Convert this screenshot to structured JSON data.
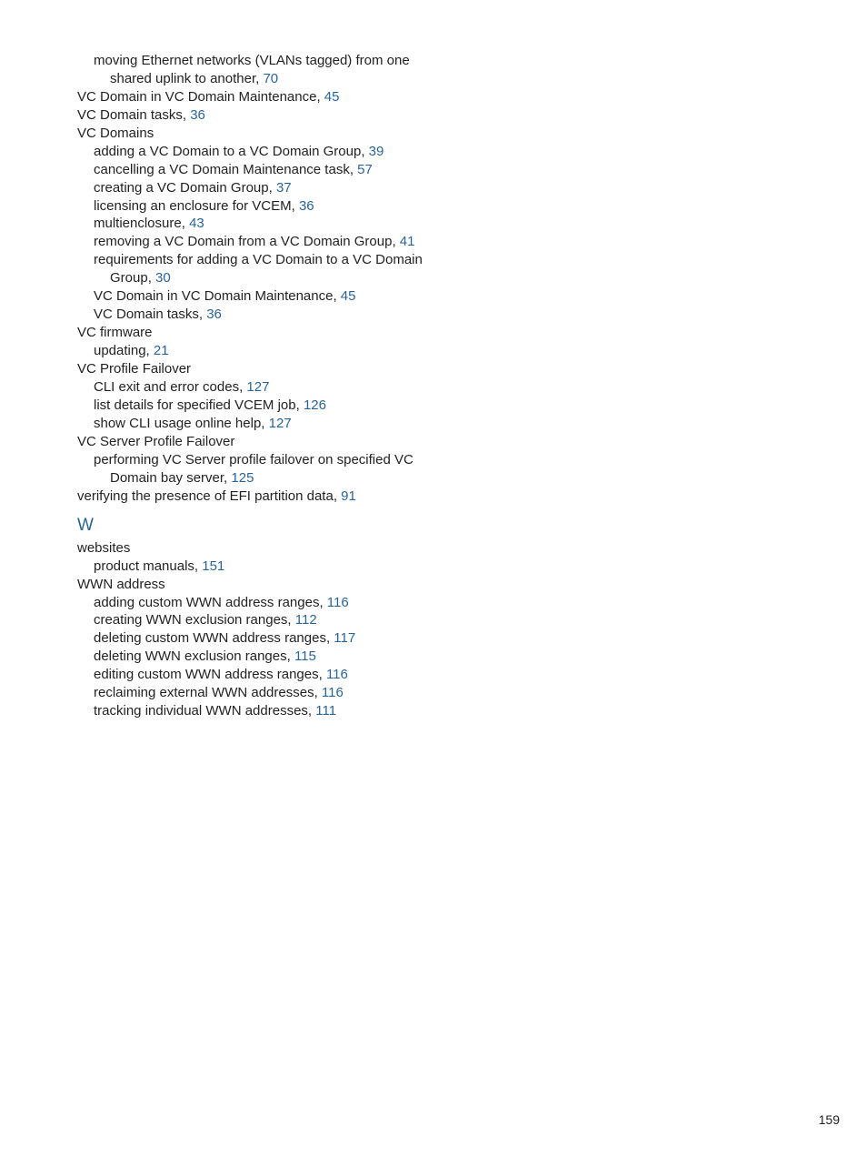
{
  "entries": [
    {
      "indent": 1,
      "text": "moving Ethernet networks (VLANs tagged) from one"
    },
    {
      "indent": 2,
      "text": "shared uplink to another,",
      "page": "70"
    },
    {
      "indent": 0,
      "text": "VC Domain in VC Domain Maintenance,",
      "page": "45"
    },
    {
      "indent": 0,
      "text": "VC Domain tasks,",
      "page": "36"
    },
    {
      "indent": 0,
      "text": "VC Domains"
    },
    {
      "indent": 1,
      "text": "adding a VC Domain to a VC Domain Group,",
      "page": "39"
    },
    {
      "indent": 1,
      "text": "cancelling a VC Domain Maintenance task,",
      "page": "57"
    },
    {
      "indent": 1,
      "text": "creating a VC Domain Group,",
      "page": "37"
    },
    {
      "indent": 1,
      "text": "licensing an enclosure for VCEM,",
      "page": "36"
    },
    {
      "indent": 1,
      "text": "multienclosure,",
      "page": "43"
    },
    {
      "indent": 1,
      "text": "removing a VC Domain from a VC Domain Group,",
      "page": "41"
    },
    {
      "indent": 1,
      "text": "requirements for adding a VC Domain to a VC Domain"
    },
    {
      "indent": 2,
      "text": "Group,",
      "page": "30"
    },
    {
      "indent": 1,
      "text": "VC Domain in VC Domain Maintenance,",
      "page": "45"
    },
    {
      "indent": 1,
      "text": "VC Domain tasks,",
      "page": "36"
    },
    {
      "indent": 0,
      "text": "VC firmware"
    },
    {
      "indent": 1,
      "text": "updating,",
      "page": "21"
    },
    {
      "indent": 0,
      "text": "VC Profile Failover"
    },
    {
      "indent": 1,
      "text": "CLI exit and error codes,",
      "page": "127"
    },
    {
      "indent": 1,
      "text": "list details for specified VCEM job,",
      "page": "126"
    },
    {
      "indent": 1,
      "text": "show CLI usage online help,",
      "page": "127"
    },
    {
      "indent": 0,
      "text": "VC Server Profile Failover"
    },
    {
      "indent": 1,
      "text": "performing VC Server profile failover on specified VC"
    },
    {
      "indent": 2,
      "text": "Domain bay server,",
      "page": "125"
    },
    {
      "indent": 0,
      "text": "verifying the presence of EFI partition data,",
      "page": "91"
    }
  ],
  "sectionW": {
    "heading": "W",
    "entries": [
      {
        "indent": 0,
        "text": "websites"
      },
      {
        "indent": 1,
        "text": "product manuals,",
        "page": "151"
      },
      {
        "indent": 0,
        "text": "WWN address"
      },
      {
        "indent": 1,
        "text": "adding custom WWN address ranges,",
        "page": "116"
      },
      {
        "indent": 1,
        "text": "creating WWN exclusion ranges,",
        "page": "112"
      },
      {
        "indent": 1,
        "text": "deleting custom WWN address ranges,",
        "page": "117"
      },
      {
        "indent": 1,
        "text": "deleting WWN exclusion ranges,",
        "page": "115"
      },
      {
        "indent": 1,
        "text": "editing custom WWN address ranges,",
        "page": "116"
      },
      {
        "indent": 1,
        "text": "reclaiming external WWN addresses,",
        "page": "116"
      },
      {
        "indent": 1,
        "text": "tracking individual WWN addresses,",
        "page": "111"
      }
    ]
  },
  "pageNumber": "159"
}
